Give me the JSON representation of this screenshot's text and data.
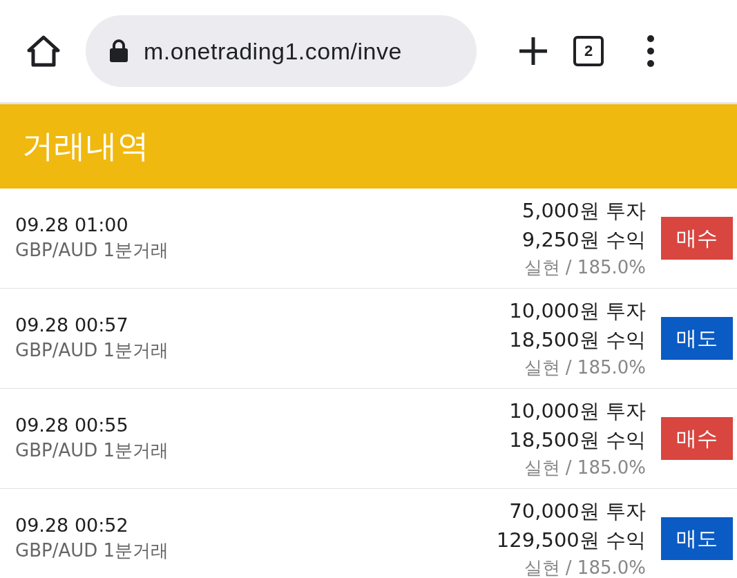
{
  "browser": {
    "url": "m.onetrading1.com/inve",
    "tab_count": "2"
  },
  "header": {
    "title": "거래내역"
  },
  "trades": [
    {
      "time": "09.28 01:00",
      "product": "GBP/AUD 1분거래",
      "investment": "5,000원 투자",
      "payout": "9,250원 수익",
      "result": "실현 / 185.0%",
      "kind": "buy",
      "side_label": "매수"
    },
    {
      "time": "09.28 00:57",
      "product": "GBP/AUD 1분거래",
      "investment": "10,000원 투자",
      "payout": "18,500원 수익",
      "result": "실현 / 185.0%",
      "kind": "sell",
      "side_label": "매도"
    },
    {
      "time": "09.28 00:55",
      "product": "GBP/AUD 1분거래",
      "investment": "10,000원 투자",
      "payout": "18,500원 수익",
      "result": "실현 / 185.0%",
      "kind": "buy",
      "side_label": "매수"
    },
    {
      "time": "09.28 00:52",
      "product": "GBP/AUD 1분거래",
      "investment": "70,000원 투자",
      "payout": "129,500원 수익",
      "result": "실현 / 185.0%",
      "kind": "sell",
      "side_label": "매도"
    }
  ]
}
